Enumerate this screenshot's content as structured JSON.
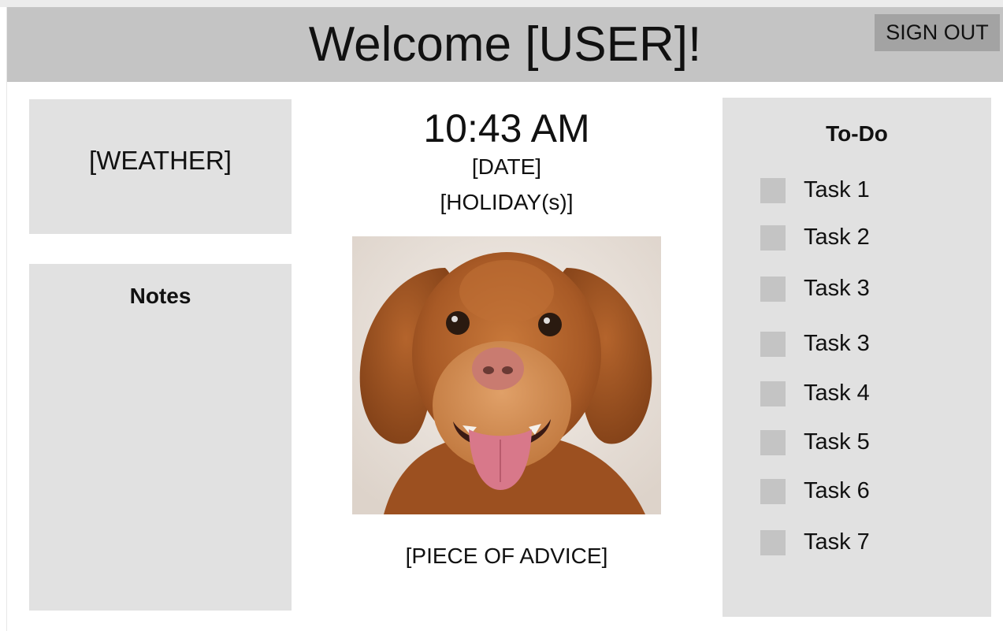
{
  "header": {
    "title": "Welcome [USER]!",
    "signout_label": "SIGN OUT"
  },
  "weather": {
    "label": "[WEATHER]"
  },
  "notes": {
    "title": "Notes"
  },
  "center": {
    "time": "10:43 AM",
    "date": "[DATE]",
    "holiday": "[HOLIDAY(s)]",
    "advice": "[PIECE OF ADVICE]"
  },
  "todo": {
    "title": "To-Do",
    "tasks": [
      {
        "label": "Task 1",
        "checked": false
      },
      {
        "label": "Task 2",
        "checked": false
      },
      {
        "label": "Task 3",
        "checked": false
      },
      {
        "label": "Task 3",
        "checked": false
      },
      {
        "label": "Task 4",
        "checked": false
      },
      {
        "label": "Task 5",
        "checked": false
      },
      {
        "label": "Task 6",
        "checked": false
      },
      {
        "label": "Task 7",
        "checked": false
      }
    ]
  },
  "colors": {
    "header_bg": "#c4c4c4",
    "signout_bg": "#a3a3a3",
    "panel_bg": "#e1e1e1",
    "checkbox": "#c4c4c4"
  }
}
